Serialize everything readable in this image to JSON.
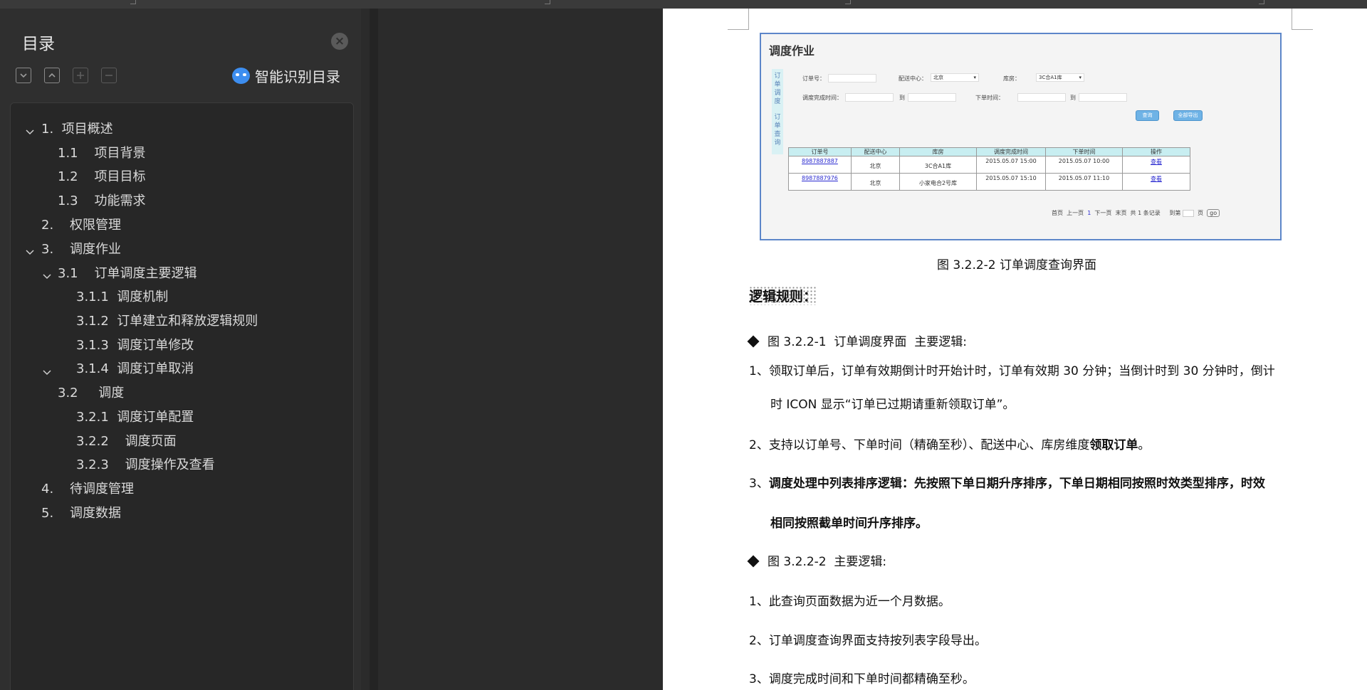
{
  "sidebar": {
    "title": "目录",
    "ai_button": "智能识别目录",
    "toc": [
      {
        "label": "1.  项目概述"
      },
      {
        "label": "1.1    项目背景"
      },
      {
        "label": "1.2    项目目标"
      },
      {
        "label": "1.3    功能需求"
      },
      {
        "label": "2.    权限管理"
      },
      {
        "label": "3.    调度作业"
      },
      {
        "label": "3.1    订单调度主要逻辑"
      },
      {
        "label": "3.1.1  调度机制"
      },
      {
        "label": "3.1.2  订单建立和释放逻辑规则"
      },
      {
        "label": "3.1.3  调度订单修改"
      },
      {
        "label": "3.1.4  调度订单取消"
      },
      {
        "label": "3.2     调度"
      },
      {
        "label": "3.2.1  调度订单配置"
      },
      {
        "label": "3.2.2    调度页面"
      },
      {
        "label": "3.2.3    调度操作及查看"
      },
      {
        "label": "4.    待调度管理"
      },
      {
        "label": "5.    调度数据"
      }
    ]
  },
  "doc": {
    "figure": {
      "title": "调度作业",
      "tabs": [
        "订单调度",
        "订单查询"
      ],
      "labels": {
        "order_no": "订单号：",
        "center": "配送中心：",
        "center_value": "北京",
        "warehouse": "库房：",
        "warehouse_value": "3C合A1库",
        "done_time": "调度完成时间：",
        "to1": "到",
        "order_time": "下单时间：",
        "to2": "到"
      },
      "buttons": {
        "query": "查询",
        "export": "全部导出"
      },
      "table": {
        "headers": [
          "订单号",
          "配送中心",
          "库房",
          "调度完成时间",
          "下单时间",
          "操作"
        ],
        "rows": [
          [
            "8987887887",
            "北京",
            "3C合A1库",
            "2015.05.07 15:00",
            "2015.05.07 10:00",
            "查看"
          ],
          [
            "8987887976",
            "北京",
            "小家电合2号库",
            "2015.05.07 15:10",
            "2015.05.07 11:10",
            "查看"
          ]
        ]
      },
      "pager": {
        "left": "首页  上一页",
        "current": "1",
        "right": "下一页  末页  共 1 条记录     到第",
        "page_unit": "页",
        "go": "go"
      }
    },
    "caption": "图 3.2.2-2  订单调度查询界面",
    "section_head": "逻辑规则：",
    "p1": "图 3.2.2-1  订单调度界面  主要逻辑:",
    "p2a": "1、领取订单后，订单有效期倒计时开始计时，订单有效期 30 分钟；当倒计时到 30 分钟时，倒计",
    "p2b": "时 ICON 显示“订单已过期请重新领取订单”。",
    "p3a": "2、支持以订单号、下单时间（精确至秒）、配送中心、库房维度",
    "p3b": "领取订单",
    "p3c": "。",
    "p4a": "3、",
    "p4b": "调度处理中列表排序逻辑：先按照下单日期升序排序，下单日期相同按照时效类型排序，时效",
    "p4c": "相同按照截单时间升序排序。",
    "p5": "图 3.2.2-2  主要逻辑:",
    "p6": "1、此查询页面数据为近一个月数据。",
    "p7": "2、订单调度查询界面支持按列表字段导出。",
    "p8": "3、调度完成时间和下单时间都精确至秒。"
  }
}
